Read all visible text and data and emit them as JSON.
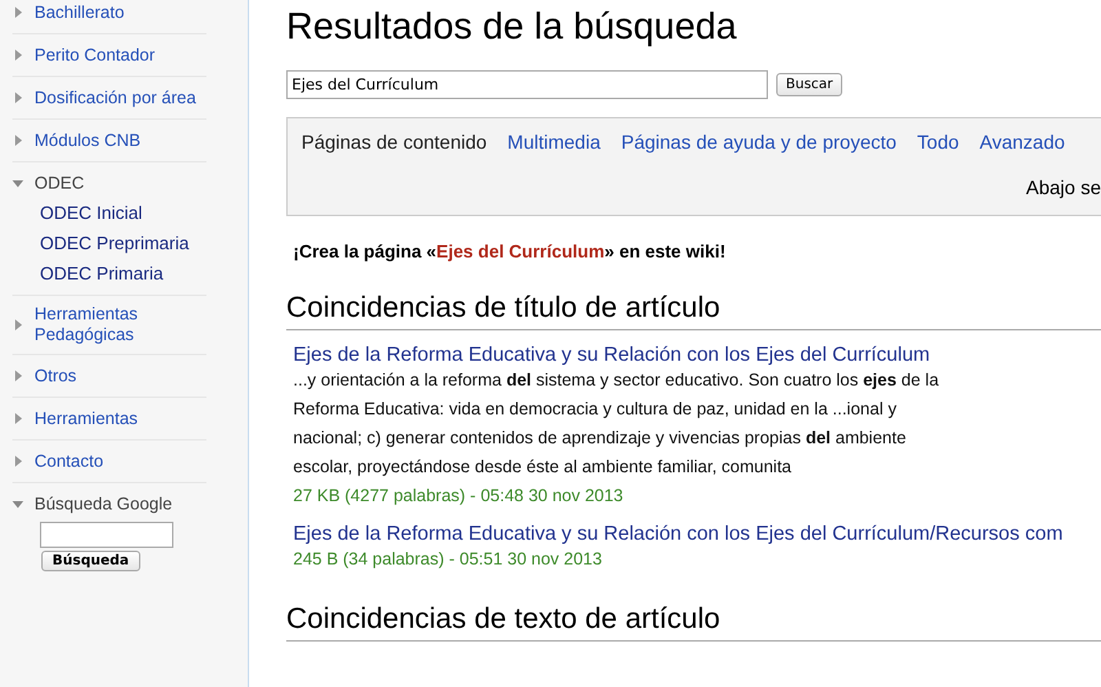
{
  "sidebar": [
    {
      "kind": "portlet",
      "label": "Bachillerato",
      "expanded": false
    },
    {
      "kind": "portlet",
      "label": "Perito Contador",
      "expanded": false
    },
    {
      "kind": "portlet",
      "label": "Dosificación por área",
      "expanded": false
    },
    {
      "kind": "portlet",
      "label": "Módulos CNB",
      "expanded": false
    },
    {
      "kind": "portlet",
      "label": "ODEC",
      "expanded": true,
      "children": [
        {
          "label": "ODEC Inicial"
        },
        {
          "label": "ODEC Preprimaria"
        },
        {
          "label": "ODEC Primaria"
        }
      ]
    },
    {
      "kind": "portlet",
      "label": "Herramientas Pedagógicas",
      "expanded": false
    },
    {
      "kind": "portlet",
      "label": "Otros",
      "expanded": false
    },
    {
      "kind": "portlet",
      "label": "Herramientas",
      "expanded": false
    },
    {
      "kind": "portlet",
      "label": "Contacto",
      "expanded": false
    },
    {
      "kind": "search",
      "label": "Búsqueda Google",
      "expanded": true,
      "button": "Búsqueda"
    }
  ],
  "title": "Resultados de la búsqueda",
  "search": {
    "value": "Ejes del Currículum",
    "button": "Buscar"
  },
  "tabs": [
    {
      "label": "Páginas de contenido",
      "selected": true
    },
    {
      "label": "Multimedia",
      "selected": false
    },
    {
      "label": "Páginas de ayuda y de proyecto",
      "selected": false
    },
    {
      "label": "Todo",
      "selected": false
    },
    {
      "label": "Avanzado",
      "selected": false
    }
  ],
  "tabs_note": "Abajo se",
  "create": {
    "before": "¡Crea la página «",
    "link": "Ejes del Currículum",
    "after": "» en este wiki!"
  },
  "sections": [
    {
      "heading": "Coincidencias de título de artículo",
      "results": [
        {
          "title": "Ejes de la Reforma Educativa y su Relación con los Ejes del Currículum",
          "snippet": "...y orientación a la reforma **del** sistema y sector educativo. Son cuatro los **ejes** de la Reforma Educativa: vida en democracia y cultura de paz, unidad en la ...ional y nacional; c) generar contenidos de aprendizaje y vivencias propias **del** ambiente escolar, proyectándose desde éste al ambiente familiar, comunita",
          "meta": "27 KB (4277 palabras) - 05:48 30 nov 2013"
        },
        {
          "title": "Ejes de la Reforma Educativa y su Relación con los Ejes del Currículum/Recursos com",
          "meta": "245 B (34 palabras) - 05:51 30 nov 2013"
        }
      ]
    },
    {
      "heading": "Coincidencias de texto de artículo"
    }
  ]
}
